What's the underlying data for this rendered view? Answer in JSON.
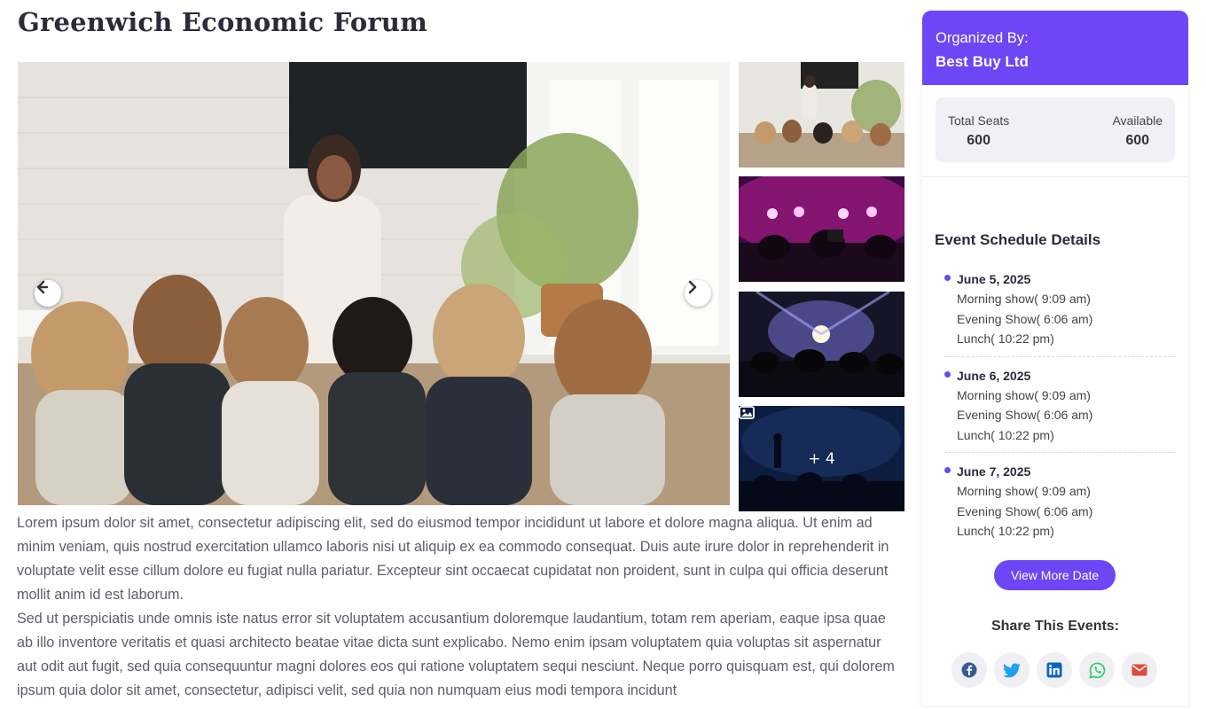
{
  "event": {
    "title": "Greenwich Economic Forum"
  },
  "gallery": {
    "main_image": "conference-presentation-photo",
    "thumbnails": [
      "conference-seminar-photo",
      "concert-crowd-pink-lights-photo",
      "concert-stage-lights-photo",
      "audience-silhouette-photo"
    ],
    "more_count_label": "+ 4",
    "prev_icon": "arrow-left-icon",
    "next_icon": "arrow-right-icon"
  },
  "description": {
    "paragraphs": [
      "Lorem ipsum dolor sit amet, consectetur adipiscing elit, sed do eiusmod tempor incididunt ut labore et dolore magna aliqua. Ut enim ad minim veniam, quis nostrud exercitation ullamco laboris nisi ut aliquip ex ea commodo consequat. Duis aute irure dolor in reprehenderit in voluptate velit esse cillum dolore eu fugiat nulla pariatur. Excepteur sint occaecat cupidatat non proident, sunt in culpa qui officia deserunt mollit anim id est laborum.",
      "Sed ut perspiciatis unde omnis iste natus error sit voluptatem accusantium doloremque laudantium, totam rem aperiam, eaque ipsa quae ab illo inventore veritatis et quasi architecto beatae vitae dicta sunt explicabo. Nemo enim ipsam voluptatem quia voluptas sit aspernatur aut odit aut fugit, sed quia consequuntur magni dolores eos qui ratione voluptatem sequi nesciunt. Neque porro quisquam est, qui dolorem ipsum quia dolor sit amet, consectetur, adipisci velit, sed quia non numquam eius modi tempora incidunt"
    ]
  },
  "sidebar": {
    "organizer_label": "Organized By:",
    "organizer_name": "Best Buy Ltd",
    "seats": {
      "total_label": "Total Seats",
      "total_value": "600",
      "available_label": "Available",
      "available_value": "600"
    },
    "schedule_title": "Event Schedule Details",
    "schedule": [
      {
        "date": "June 5, 2025",
        "lines": [
          "Morning show( 9:09 am)",
          "Evening Show( 6:06 am)",
          "Lunch( 10:22 pm)"
        ]
      },
      {
        "date": "June 6, 2025",
        "lines": [
          "Morning show( 9:09 am)",
          "Evening Show( 6:06 am)",
          "Lunch( 10:22 pm)"
        ]
      },
      {
        "date": "June 7, 2025",
        "lines": [
          "Morning show( 9:09 am)",
          "Evening Show( 6:06 am)",
          "Lunch( 10:22 pm)"
        ]
      }
    ],
    "view_more_label": "View More Date",
    "share_title": "Share This Events:",
    "share_icons": [
      "facebook-icon",
      "twitter-icon",
      "linkedin-icon",
      "whatsapp-icon",
      "email-icon"
    ]
  },
  "colors": {
    "accent": "#6e46f5",
    "facebook": "#3b5998",
    "twitter": "#1da1f2",
    "linkedin": "#0a66c2",
    "whatsapp": "#25d366",
    "email": "#dd4b39"
  }
}
